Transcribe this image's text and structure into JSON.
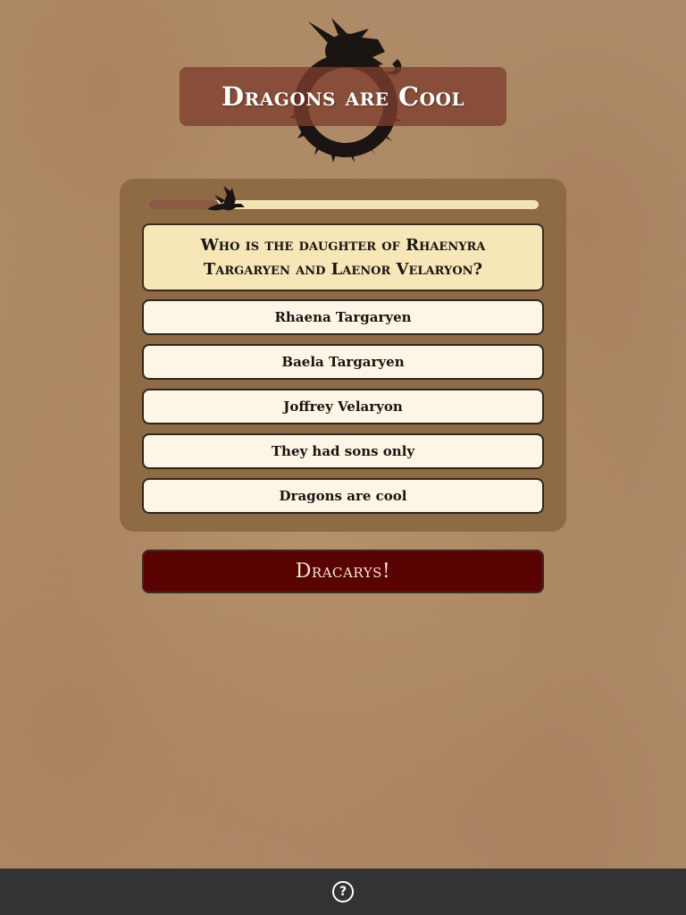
{
  "header": {
    "title": "Dragons are Cool",
    "emblem_icon": "ouroboros-dragon-icon"
  },
  "quiz": {
    "progress_fraction": 0.18,
    "progress_icon": "flying-dragon-icon",
    "question": "Who is the daughter of Rhaenyra Targaryen and Laenor Velaryon?",
    "answers": [
      "Rhaena Targaryen",
      "Baela Targaryen",
      "Joffrey Velaryon",
      "They had sons only",
      "Dragons are cool"
    ],
    "submit_label": "Dracarys!"
  },
  "bottom_bar": {
    "help_icon": "help-circle-icon",
    "help_glyph": "?"
  },
  "colors": {
    "title_bg": "#7d3e2d",
    "card_bg": "#8e6a45",
    "question_bg": "#f6e6b8",
    "answer_bg": "#fdf6e6",
    "submit_bg": "#5a0303",
    "bottom_bar_bg": "#333333"
  }
}
